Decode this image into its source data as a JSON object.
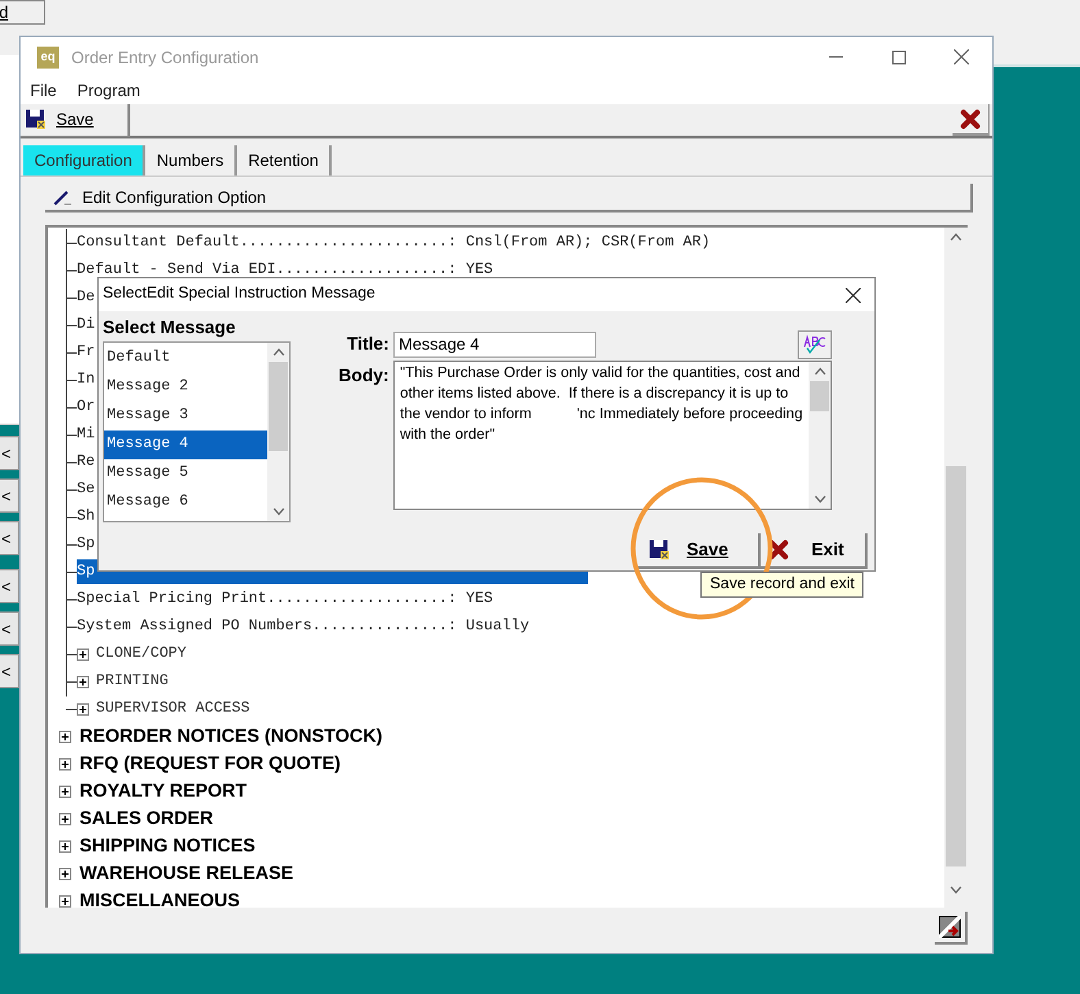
{
  "background_window": {
    "button_label": "d",
    "side_buttons": [
      "<",
      "<",
      "<",
      "<",
      "<",
      "<"
    ]
  },
  "window": {
    "app_icon_text": "eq",
    "title": "Order Entry Configuration",
    "active": false
  },
  "menu": [
    "File",
    "Program"
  ],
  "toolbar": {
    "save_label": "Save"
  },
  "tabs": [
    {
      "label": "Configuration",
      "selected": true
    },
    {
      "label": "Numbers",
      "selected": false
    },
    {
      "label": "Retention",
      "selected": false
    }
  ],
  "edit_button": "Edit Configuration Option",
  "tree": {
    "nested_items": [
      {
        "kind": "setting",
        "text": "Consultant Default.......................: Cnsl(From AR); CSR(From AR)",
        "selected": false
      },
      {
        "kind": "setting",
        "text": "Default - Send Via EDI...................: YES",
        "selected": false
      },
      {
        "kind": "setting",
        "text": "De",
        "selected": false
      },
      {
        "kind": "setting",
        "text": "Di",
        "selected": false
      },
      {
        "kind": "setting",
        "text": "Fr",
        "selected": false
      },
      {
        "kind": "setting",
        "text": "In",
        "selected": false
      },
      {
        "kind": "setting",
        "text": "Or",
        "selected": false
      },
      {
        "kind": "setting",
        "text": "Mi",
        "selected": false
      },
      {
        "kind": "setting",
        "text": "Re",
        "selected": false
      },
      {
        "kind": "setting",
        "text": "Se",
        "selected": false
      },
      {
        "kind": "setting",
        "text": "Sh",
        "selected": false
      },
      {
        "kind": "setting",
        "text": "Sp",
        "selected": false
      },
      {
        "kind": "setting",
        "text": "Sp",
        "selected": true
      },
      {
        "kind": "setting",
        "text": "Special Pricing Print....................: YES",
        "selected": false
      },
      {
        "kind": "setting",
        "text": "System Assigned PO Numbers...............: Usually",
        "selected": false
      },
      {
        "kind": "group",
        "text": "CLONE/COPY",
        "expanded": false
      },
      {
        "kind": "group",
        "text": "PRINTING",
        "expanded": false
      },
      {
        "kind": "group",
        "text": "SUPERVISOR ACCESS",
        "expanded": false
      }
    ],
    "items": [
      {
        "text": "REORDER NOTICES (NONSTOCK)",
        "expanded": false
      },
      {
        "text": "RFQ (REQUEST FOR QUOTE)",
        "expanded": false
      },
      {
        "text": "ROYALTY REPORT",
        "expanded": false
      },
      {
        "text": "SALES ORDER",
        "expanded": false
      },
      {
        "text": "SHIPPING NOTICES",
        "expanded": false
      },
      {
        "text": "WAREHOUSE RELEASE",
        "expanded": false
      },
      {
        "text": "MISCELLANEOUS",
        "expanded": false
      }
    ]
  },
  "dialog": {
    "title": "SelectEdit Special Instruction Message",
    "list_heading": "Select Message",
    "messages": [
      {
        "label": "Default",
        "selected": false
      },
      {
        "label": "Message 2",
        "selected": false
      },
      {
        "label": "Message 3",
        "selected": false
      },
      {
        "label": "Message 4",
        "selected": true
      },
      {
        "label": "Message 5",
        "selected": false
      },
      {
        "label": "Message 6",
        "selected": false
      }
    ],
    "title_label": "Title:",
    "title_value": "Message 4",
    "body_label": "Body:",
    "body_value": "\"This Purchase Order is only valid for the quantities, cost and other items listed above.  If there is a discrepancy it is up to the vendor to inform           'nc Immediately before proceeding with the order\"",
    "save_label": "Save",
    "exit_label": "Exit",
    "tooltip": "Save record and exit"
  }
}
